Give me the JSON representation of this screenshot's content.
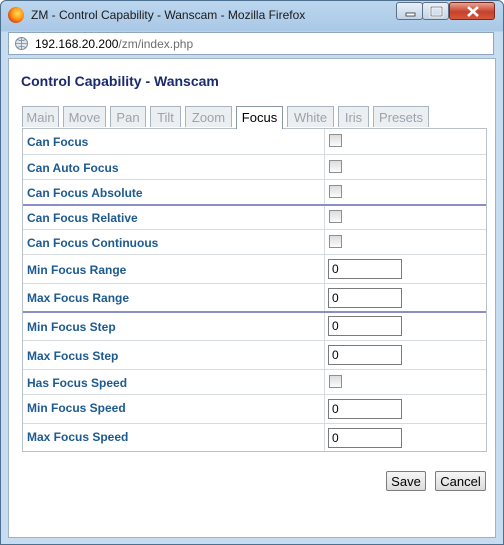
{
  "window": {
    "title": "ZM - Control Capability - Wanscam - Mozilla Firefox"
  },
  "address": {
    "host": "192.168.20.200",
    "path": "/zm/index.php"
  },
  "page": {
    "title": "Control Capability - Wanscam"
  },
  "tabs": [
    "Main",
    "Move",
    "Pan",
    "Tilt",
    "Zoom",
    "Focus",
    "White",
    "Iris",
    "Presets"
  ],
  "active_tab": "Focus",
  "fields": [
    {
      "label": "Can Focus",
      "type": "checkbox",
      "checked": false
    },
    {
      "label": "Can Auto Focus",
      "type": "checkbox",
      "checked": false
    },
    {
      "label": "Can Focus Absolute",
      "type": "checkbox",
      "checked": false
    },
    {
      "label": "Can Focus Relative",
      "type": "checkbox",
      "checked": false
    },
    {
      "label": "Can Focus Continuous",
      "type": "checkbox",
      "checked": false
    },
    {
      "label": "Min Focus Range",
      "type": "text",
      "value": "0"
    },
    {
      "label": "Max Focus Range",
      "type": "text",
      "value": "0"
    },
    {
      "label": "Min Focus Step",
      "type": "text",
      "value": "0"
    },
    {
      "label": "Max Focus Step",
      "type": "text",
      "value": "0"
    },
    {
      "label": "Has Focus Speed",
      "type": "checkbox",
      "checked": false
    },
    {
      "label": "Min Focus Speed",
      "type": "text",
      "value": "0"
    },
    {
      "label": "Max Focus Speed",
      "type": "text",
      "value": "0"
    }
  ],
  "buttons": {
    "save": "Save",
    "cancel": "Cancel"
  }
}
